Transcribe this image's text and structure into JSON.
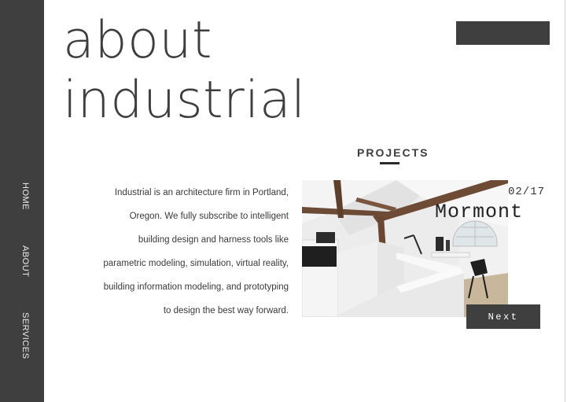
{
  "sidebar": {
    "items": [
      {
        "label": "HOME"
      },
      {
        "label": "ABOUT"
      },
      {
        "label": "SERVICES"
      }
    ]
  },
  "hero": {
    "title_line1": "about",
    "title_line2": "industrial"
  },
  "header": {
    "top_button_label": ""
  },
  "projects": {
    "heading": "PROJECTS",
    "counter": "02/17",
    "name": "Mormont",
    "next_label": "Next",
    "image_icon": "loft-office-photo"
  },
  "about": {
    "lines": [
      "Industrial is an architecture firm in Portland,",
      "Oregon.  We fully subscribe to intelligent",
      "building design and harness tools like",
      "parametric modeling, simulation, virtual reality,",
      "building information modeling, and prototyping",
      "to design the best way forward."
    ]
  },
  "colors": {
    "sidebar_bg": "#3f3f3f",
    "text": "#3d3d3d",
    "background": "#ffffff"
  }
}
